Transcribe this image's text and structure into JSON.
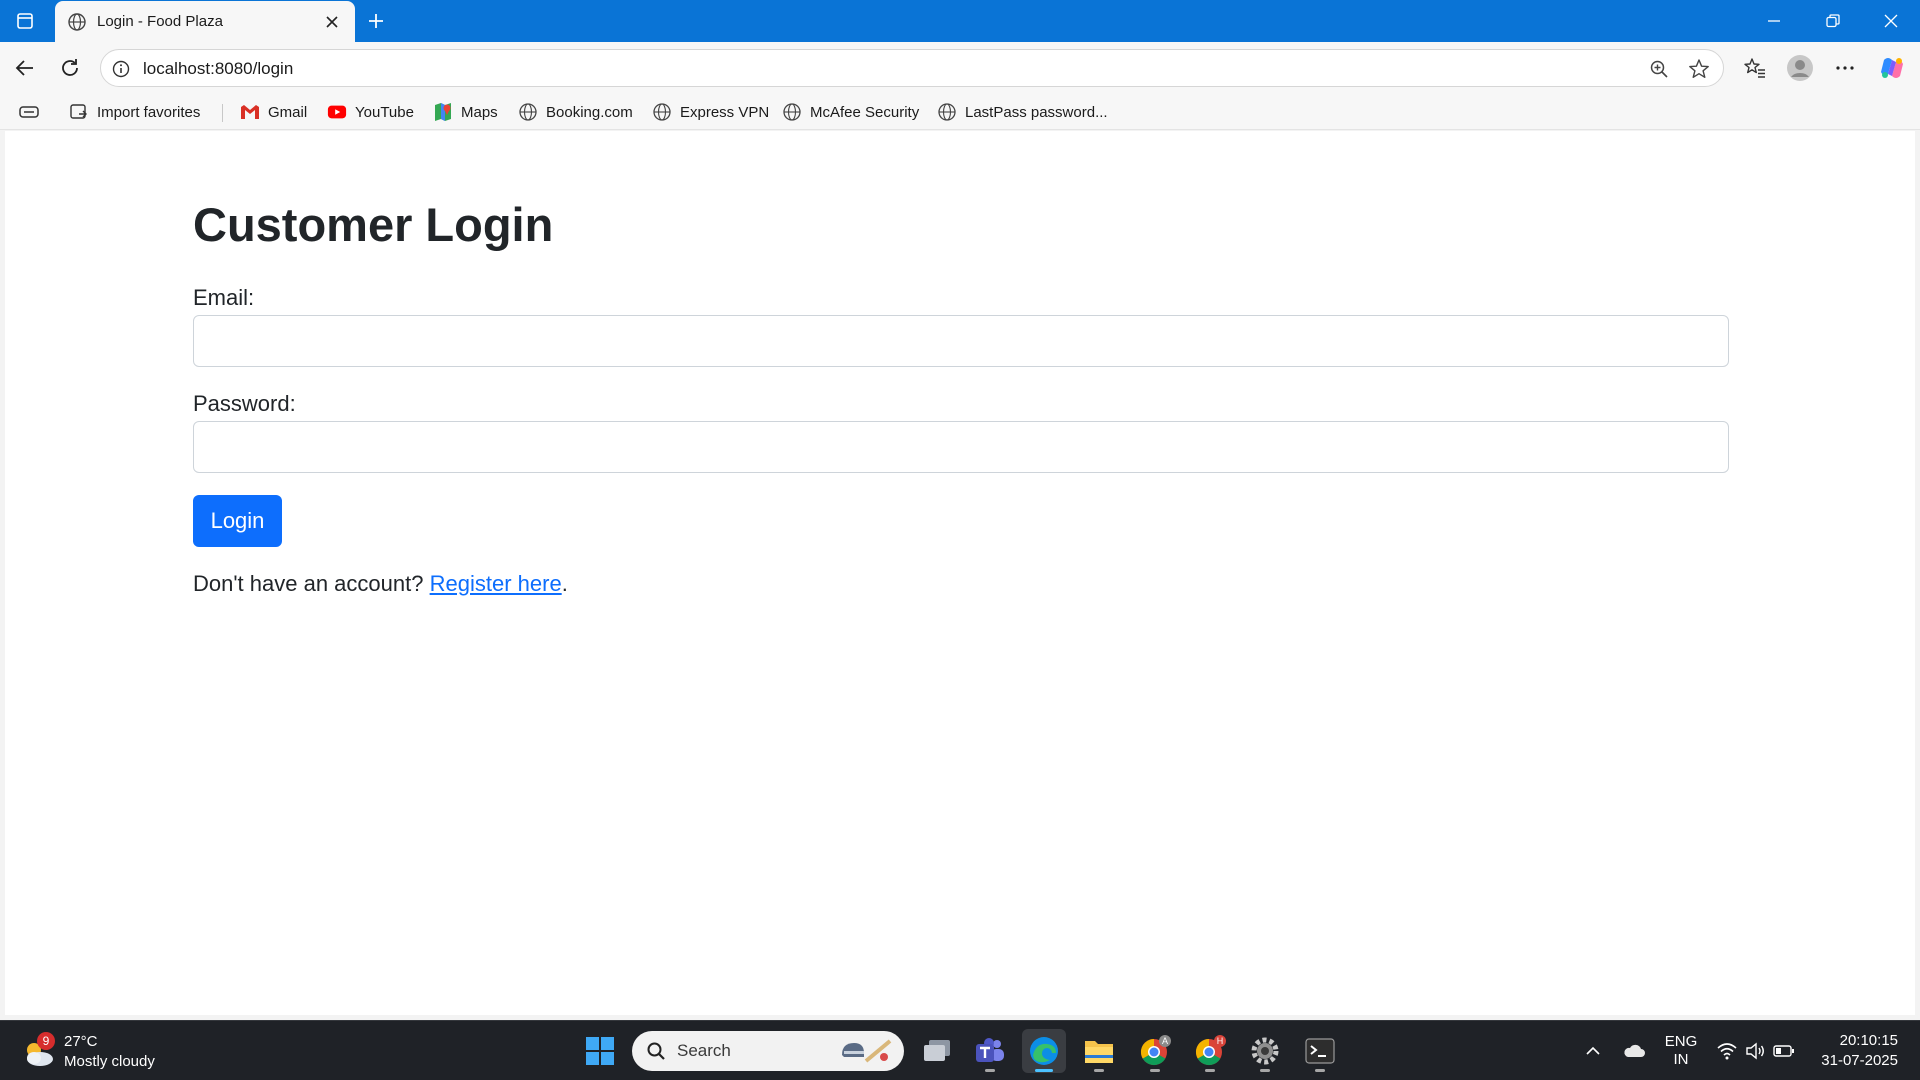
{
  "browser": {
    "tab_title": "Login - Food Plaza",
    "url": "localhost:8080/login"
  },
  "bookmarks": [
    {
      "label": "Import favorites",
      "icon": "import-icon"
    },
    {
      "label": "Gmail",
      "icon": "gmail-icon"
    },
    {
      "label": "YouTube",
      "icon": "youtube-icon"
    },
    {
      "label": "Maps",
      "icon": "maps-icon"
    },
    {
      "label": "Booking.com",
      "icon": "globe-icon"
    },
    {
      "label": "Express VPN",
      "icon": "globe-icon"
    },
    {
      "label": "McAfee Security",
      "icon": "globe-icon"
    },
    {
      "label": "LastPass password...",
      "icon": "globe-icon"
    }
  ],
  "page": {
    "title": "Customer Login",
    "email_label": "Email:",
    "email_value": "",
    "password_label": "Password:",
    "password_value": "",
    "login_button": "Login",
    "register_prompt": "Don't have an account?",
    "register_link": "Register here",
    "register_suffix": "."
  },
  "taskbar": {
    "weather_temp": "27°C",
    "weather_desc": "Mostly cloudy",
    "weather_badge": "9",
    "search_placeholder": "Search",
    "lang_top": "ENG",
    "lang_bottom": "IN",
    "time": "20:10:15",
    "date": "31-07-2025",
    "apps": [
      "file-explorer-window-icon",
      "teams-icon",
      "edge-icon",
      "folder-icon",
      "chrome-profile-a-icon",
      "chrome-profile-h-icon",
      "settings-icon",
      "terminal-icon"
    ],
    "chrome_badges": [
      "A",
      "H"
    ]
  },
  "colors": {
    "titlebar": "#0a74d6",
    "primary": "#0d6efd",
    "text": "#212529",
    "taskbar": "#1f2227"
  }
}
